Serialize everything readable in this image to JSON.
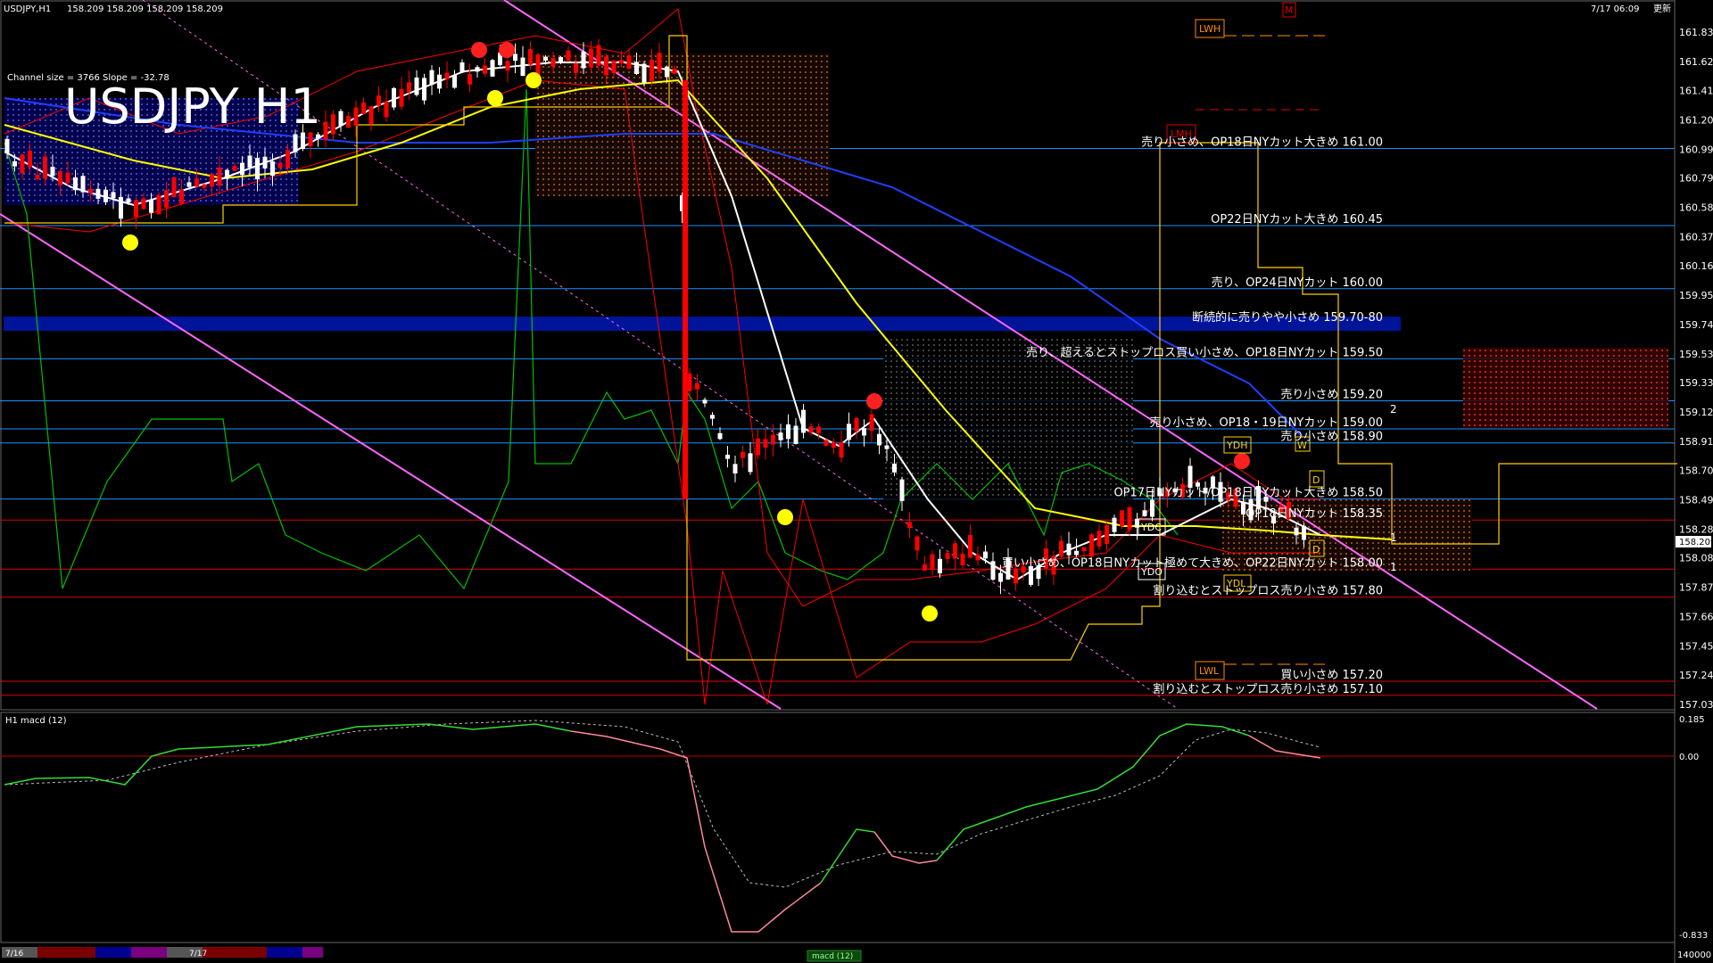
{
  "header": {
    "symbol_info": "USDJPY,H1",
    "ohlc": "158.209 158.209 158.209 158.209",
    "datetime": "7/17 06:09",
    "status": "更新",
    "channel_info": "Channel size = 3766 Slope = -32.78",
    "title": "USDJPY H1",
    "m_badge": "M"
  },
  "price_axis": {
    "labels": [
      "161.830",
      "161.620",
      "161.415",
      "161.205",
      "160.995",
      "160.790",
      "160.580",
      "160.370",
      "160.165",
      "159.955",
      "159.745",
      "159.535",
      "159.330",
      "159.120",
      "158.910",
      "158.705",
      "158.495",
      "158.285",
      "158.080",
      "157.870",
      "157.660",
      "157.450",
      "157.245",
      "157.035"
    ],
    "current_price": "158.209",
    "right_marks": [
      "2",
      "1",
      "1"
    ]
  },
  "levels": [
    {
      "text": "売り小さめ、OP18日NYカット大きめ 161.00",
      "color": "#1e90ff"
    },
    {
      "text": "OP22日NYカット大きめ 160.45",
      "color": "#1e90ff"
    },
    {
      "text": "売り、OP24日NYカット 160.00",
      "color": "#1e90ff"
    },
    {
      "text": "断続的に売りやや小さめ 159.70-80",
      "color": "#001a9e"
    },
    {
      "text": "売り、超えるとストップロス買い小さめ、OP18日NYカット 159.50",
      "color": "#1e90ff"
    },
    {
      "text": "売り小さめ 159.20",
      "color": "#1e90ff"
    },
    {
      "text": "売り小さめ、OP18・19日NYカット 159.00",
      "color": "#1e90ff"
    },
    {
      "text": "売り小さめ 158.90",
      "color": "#1e90ff"
    },
    {
      "text": "OP17日NYカット/OP18日NYカット大きめ 158.50",
      "color": "#1e90ff"
    },
    {
      "text": "OP18日NYカット 158.35",
      "color": "#e00000"
    },
    {
      "text": "買い小さめ、OP18日NYカット極めて大きめ、OP22日NYカット 158.00",
      "color": "#e00000"
    },
    {
      "text": "割り込むとストップロス売り小さめ 157.80",
      "color": "#e00000"
    },
    {
      "text": "買い小さめ 157.20",
      "color": "#e00000"
    },
    {
      "text": "割り込むとストップロス売り小さめ 157.10",
      "color": "#e00000"
    }
  ],
  "badges": {
    "lwh": "LWH",
    "lmh": "LMH",
    "ydh": "YDH",
    "ydc": "YDC",
    "ydo": "YDO",
    "ydl": "YDL",
    "lwl": "LWL",
    "w": "W",
    "d": "D",
    "m": "M"
  },
  "macd": {
    "title": "H1 macd (12)",
    "axis_top": "0.185",
    "axis_mid": "0.00",
    "axis_bottom": "-0.833",
    "axis_volume": "140000",
    "tab": "macd (12)"
  },
  "time_axis": {
    "labels": [
      "7/16",
      "7/17"
    ]
  },
  "colors": {
    "background": "#000000",
    "candle_up": "#ffffff",
    "candle_down": "#ff0000",
    "ma_white": "#ffffff",
    "ma_yellow": "#ffff00",
    "ma_blue": "#1f3fff",
    "bollinger": "#ff0000",
    "rsi_green": "#00c000",
    "channel_pink": "#ff66ff",
    "kumo": "#ff8c40",
    "macd_green": "#33dd33",
    "macd_pink": "#ff8899",
    "level_blue": "#1e90ff",
    "level_red": "#e00000"
  }
}
